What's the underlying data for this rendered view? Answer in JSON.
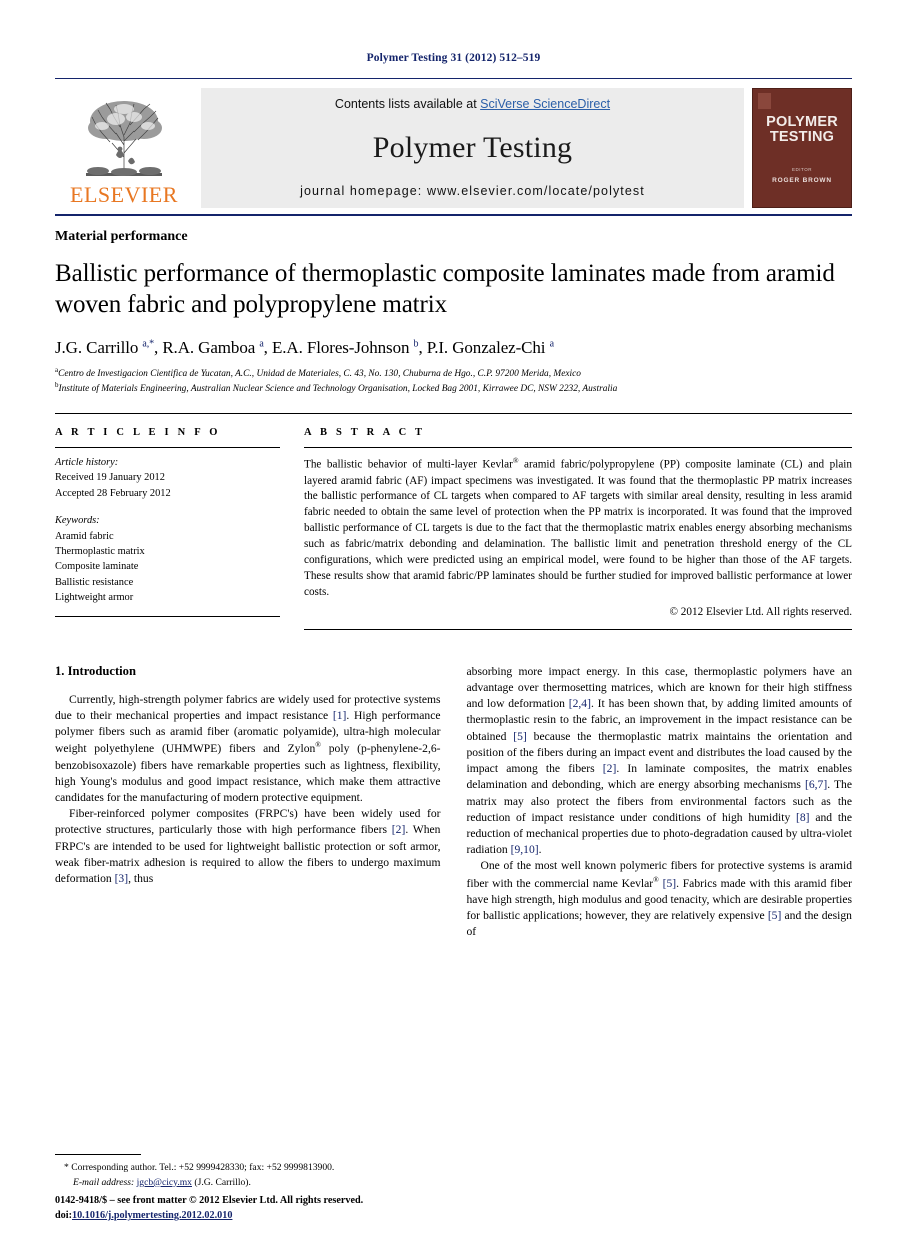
{
  "running_head": "Polymer Testing 31 (2012) 512–519",
  "banner": {
    "publisher": "ELSEVIER",
    "contents_prefix": "Contents lists available at ",
    "contents_link": "SciVerse ScienceDirect",
    "journal_name": "Polymer Testing",
    "homepage": "journal homepage: www.elsevier.com/locate/polytest",
    "cover": {
      "line1": "POLYMER",
      "line2": "TESTING",
      "ed_label": "EDITOR",
      "editor": "ROGER BROWN"
    }
  },
  "article": {
    "kicker": "Material performance",
    "title": "Ballistic performance of thermoplastic composite laminates made from aramid woven fabric and polypropylene matrix",
    "authors_html": "J.G. Carrillo <sup>a,*</sup>, R.A. Gamboa <sup>a</sup>, E.A. Flores-Johnson <sup>b</sup>, P.I. Gonzalez-Chi <sup>a</sup>",
    "affiliation_a": "Centro de Investigacion Cientifica de Yucatan, A.C., Unidad de Materiales, C. 43, No. 130, Chuburna de Hgo., C.P. 97200 Merida, Mexico",
    "affiliation_b": "Institute of Materials Engineering, Australian Nuclear Science and Technology Organisation, Locked Bag 2001, Kirrawee DC, NSW 2232, Australia"
  },
  "article_info": {
    "heading": "A R T I C L E  I N F O",
    "history_label": "Article history:",
    "received": "Received 19 January 2012",
    "accepted": "Accepted 28 February 2012",
    "keywords_label": "Keywords:",
    "keywords": [
      "Aramid fabric",
      "Thermoplastic matrix",
      "Composite laminate",
      "Ballistic resistance",
      "Lightweight armor"
    ]
  },
  "abstract": {
    "heading": "A B S T R A C T",
    "body": "The ballistic behavior of multi-layer Kevlar® aramid fabric/polypropylene (PP) composite laminate (CL) and plain layered aramid fabric (AF) impact specimens was investigated. It was found that the thermoplastic PP matrix increases the ballistic performance of CL targets when compared to AF targets with similar areal density, resulting in less aramid fabric needed to obtain the same level of protection when the PP matrix is incorporated. It was found that the improved ballistic performance of CL targets is due to the fact that the thermoplastic matrix enables energy absorbing mechanisms such as fabric/matrix debonding and delamination. The ballistic limit and penetration threshold energy of the CL configurations, which were predicted using an empirical model, were found to be higher than those of the AF targets. These results show that aramid fabric/PP laminates should be further studied for improved ballistic performance at lower costs.",
    "copyright": "© 2012 Elsevier Ltd. All rights reserved."
  },
  "introduction": {
    "heading": "1. Introduction",
    "left_paragraphs": [
      "Currently, high-strength polymer fabrics are widely used for protective systems due to their mechanical properties and impact resistance [1]. High performance polymer fibers such as aramid fiber (aromatic polyamide), ultra-high molecular weight polyethylene (UHMWPE) fibers and Zylon® poly (p-phenylene-2,6-benzobisoxazole) fibers have remarkable properties such as lightness, flexibility, high Young's modulus and good impact resistance, which make them attractive candidates for the manufacturing of modern protective equipment.",
      "Fiber-reinforced polymer composites (FRPC's) have been widely used for protective structures, particularly those with high performance fibers [2]. When FRPC's are intended to be used for lightweight ballistic protection or soft armor, weak fiber-matrix adhesion is required to allow the fibers to undergo maximum deformation [3], thus"
    ],
    "right_paragraphs": [
      "absorbing more impact energy. In this case, thermoplastic polymers have an advantage over thermosetting matrices, which are known for their high stiffness and low deformation [2,4]. It has been shown that, by adding limited amounts of thermoplastic resin to the fabric, an improvement in the impact resistance can be obtained [5] because the thermoplastic matrix maintains the orientation and position of the fibers during an impact event and distributes the load caused by the impact among the fibers [2]. In laminate composites, the matrix enables delamination and debonding, which are energy absorbing mechanisms [6,7]. The matrix may also protect the fibers from environmental factors such as the reduction of impact resistance under conditions of high humidity [8] and the reduction of mechanical properties due to photo-degradation caused by ultra-violet radiation [9,10].",
      "One of the most well known polymeric fibers for protective systems is aramid fiber with the commercial name Kevlar® [5]. Fabrics made with this aramid fiber have high strength, high modulus and good tenacity, which are desirable properties for ballistic applications; however, they are relatively expensive [5] and the design of"
    ]
  },
  "footnote": {
    "marker": "*",
    "corresponding": "Corresponding author. Tel.: +52 9999428330; fax: +52 9999813900.",
    "email_label": "E-mail address:",
    "email": "jgcb@cicy.mx",
    "email_owner": "(J.G. Carrillo)."
  },
  "footer": {
    "issn_line": "0142-9418/$ – see front matter © 2012 Elsevier Ltd. All rights reserved.",
    "doi_label": "doi:",
    "doi": "10.1016/j.polymertesting.2012.02.010"
  },
  "colors": {
    "accent_blue": "#14246b",
    "link_blue": "#2b5fa8",
    "elsevier_orange": "#e87722",
    "cover_maroon": "#6e2f26",
    "banner_gray": "#ececec"
  }
}
